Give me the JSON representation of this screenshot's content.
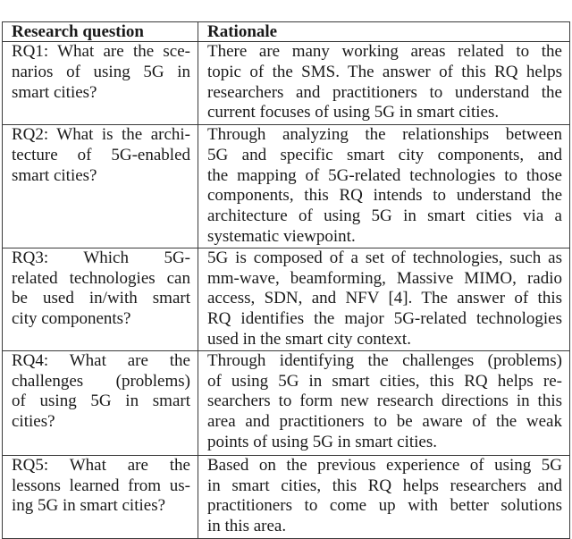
{
  "table": {
    "headers": {
      "question": "Research question",
      "rationale": "Rationale"
    },
    "rows": [
      {
        "question_lines": [
          "RQ1: What are the sce-",
          "narios of using 5G in",
          "smart cities?"
        ],
        "rationale_lines": [
          "There are many working areas related to the",
          "topic of the SMS. The answer of this RQ helps",
          "researchers and practitioners to understand the",
          "current focuses of using 5G in smart cities."
        ]
      },
      {
        "question_lines": [
          "RQ2: What is the archi-",
          "tecture of 5G-enabled",
          "smart cities?"
        ],
        "rationale_lines": [
          "Through analyzing the relationships between",
          "5G and specific smart city components, and",
          "the mapping of 5G-related technologies to those",
          "components, this RQ intends to understand the",
          "architecture of using 5G in smart cities via a",
          "systematic viewpoint."
        ]
      },
      {
        "question_lines": [
          "RQ3: Which 5G-",
          "related technologies can",
          "be used in/with smart",
          "city components?"
        ],
        "rationale_lines": [
          "5G is composed of a set of technologies, such as",
          "mm-wave, beamforming, Massive MIMO, radio",
          "access, SDN, and NFV [4]. The answer of this",
          "RQ identifies the major 5G-related technologies",
          "used in the smart city context."
        ]
      },
      {
        "question_lines": [
          "RQ4: What are the",
          "challenges (problems)",
          "of using 5G in smart",
          "cities?"
        ],
        "rationale_lines": [
          "Through identifying the challenges (problems)",
          "of using 5G in smart cities, this RQ helps re-",
          "searchers to form new research directions in this",
          "area and practitioners to be aware of the weak",
          "points of using 5G in smart cities."
        ]
      },
      {
        "question_lines": [
          "RQ5: What are the",
          "lessons learned from us-",
          "ing 5G in smart cities?"
        ],
        "rationale_lines": [
          "Based on the previous experience of using 5G",
          "in smart cities, this RQ helps researchers and",
          "practitioners to come up with better solutions",
          "in this area."
        ]
      }
    ]
  }
}
